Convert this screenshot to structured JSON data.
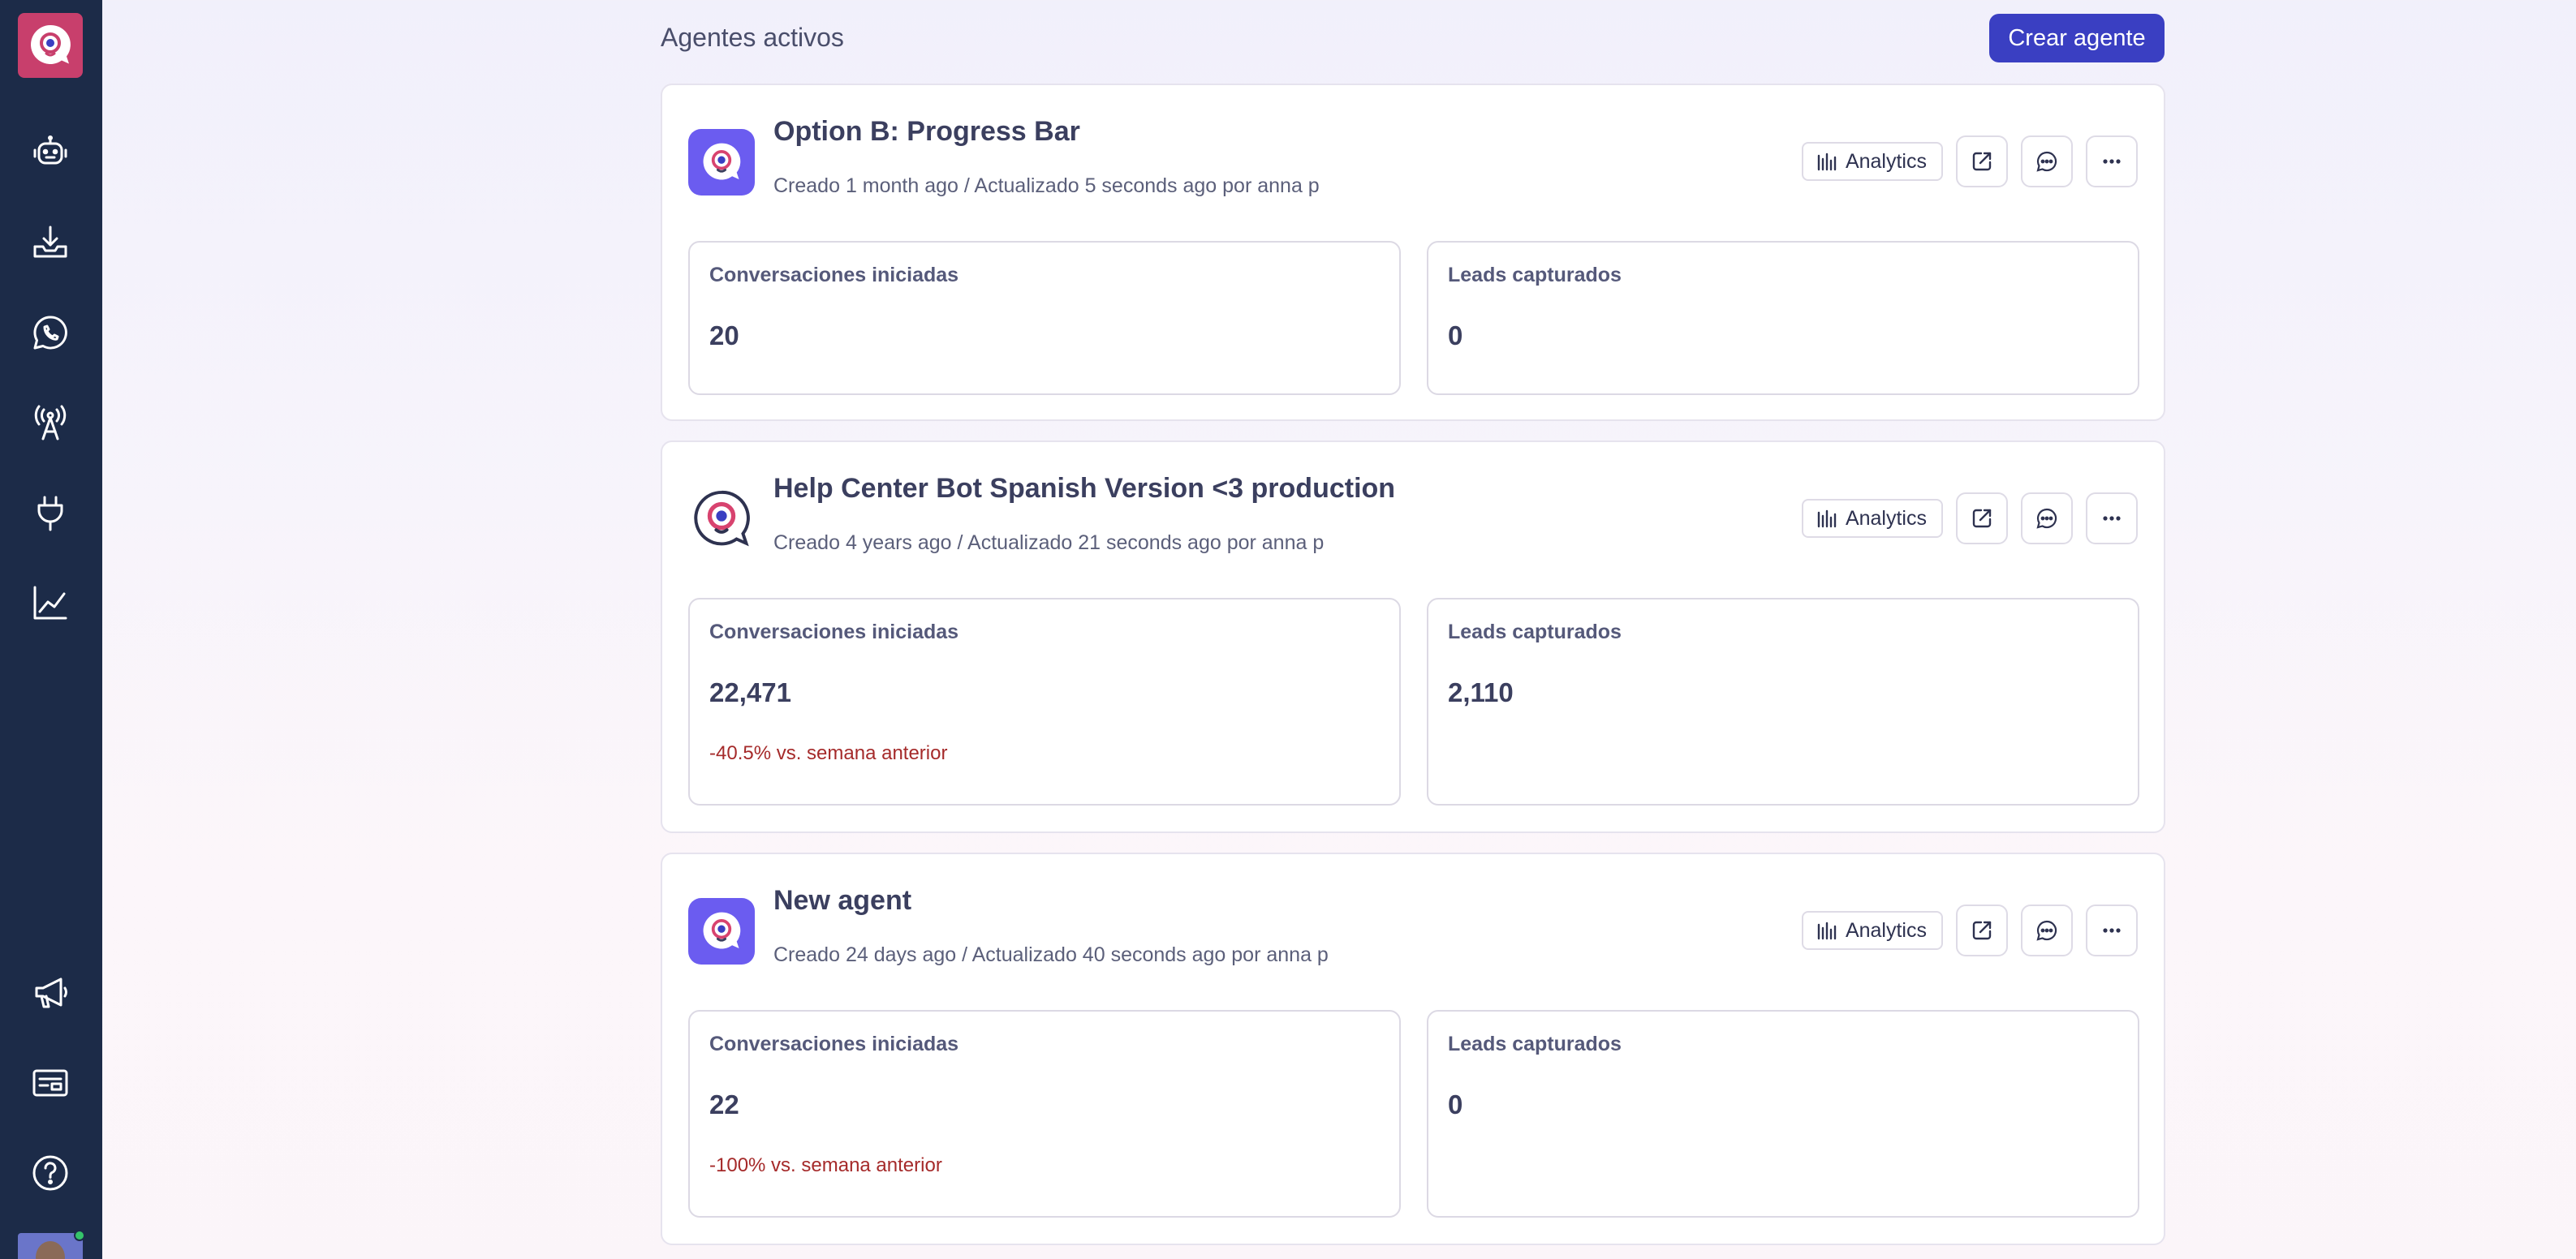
{
  "colors": {
    "sidebar": "#1c2b48",
    "accent": "#3a3fc2",
    "logo": "#c83f6c",
    "negative_delta": "#a52a2a"
  },
  "sidebar": {
    "logo_icon": "chat-eye-logo-icon",
    "items": [
      {
        "name": "agents",
        "icon": "robot-icon"
      },
      {
        "name": "inbox",
        "icon": "inbox-download-icon"
      },
      {
        "name": "whatsapp",
        "icon": "whatsapp-icon"
      },
      {
        "name": "channels",
        "icon": "broadcast-antenna-icon"
      },
      {
        "name": "integrations",
        "icon": "plug-icon"
      },
      {
        "name": "analytics",
        "icon": "line-chart-icon"
      },
      {
        "name": "announcements",
        "icon": "megaphone-icon"
      },
      {
        "name": "billing",
        "icon": "card-icon"
      },
      {
        "name": "help",
        "icon": "help-circle-icon"
      }
    ]
  },
  "header": {
    "title": "Agentes activos",
    "create_label": "Crear agente"
  },
  "agents": [
    {
      "name": "Option B: Progress Bar",
      "meta": "Creado 1 month ago / Actualizado 5 seconds ago por anna p",
      "analytics_label": "Analytics",
      "stats": [
        {
          "label": "Conversaciones iniciadas",
          "value": "20",
          "delta": ""
        },
        {
          "label": "Leads capturados",
          "value": "0",
          "delta": ""
        }
      ]
    },
    {
      "name": "Help Center Bot Spanish Version <3 production",
      "meta": "Creado 4 years ago / Actualizado 21 seconds ago por anna p",
      "analytics_label": "Analytics",
      "stats": [
        {
          "label": "Conversaciones iniciadas",
          "value": "22,471",
          "delta": "-40.5% vs. semana anterior"
        },
        {
          "label": "Leads capturados",
          "value": "2,110",
          "delta": ""
        }
      ]
    },
    {
      "name": "New agent",
      "meta": "Creado 24 days ago / Actualizado 40 seconds ago por anna p",
      "analytics_label": "Analytics",
      "stats": [
        {
          "label": "Conversaciones iniciadas",
          "value": "22",
          "delta": "-100% vs. semana anterior"
        },
        {
          "label": "Leads capturados",
          "value": "0",
          "delta": ""
        }
      ]
    }
  ]
}
